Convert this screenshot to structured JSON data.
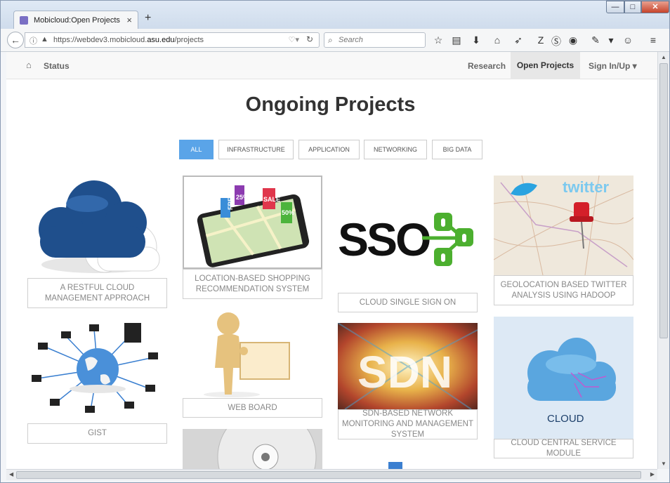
{
  "browser": {
    "tab_title": "Mobicloud:Open Projects",
    "tab_close": "×",
    "new_tab": "+",
    "url_prefix": "https://webdev3.mobicloud.",
    "url_domain": "asu.edu",
    "url_path": "/projects",
    "search_placeholder": "Search",
    "controls": {
      "minimize": "—",
      "maximize": "□",
      "close": "✕"
    }
  },
  "site_nav": {
    "status": "Status",
    "research": "Research",
    "open_projects": "Open Projects",
    "sign_in": "Sign In/Up ▾"
  },
  "page": {
    "heading": "Ongoing Projects",
    "filters": [
      "ALL",
      "INFRASTRUCTURE",
      "APPLICATION",
      "NETWORKING",
      "BIG DATA"
    ],
    "active_filter": "ALL"
  },
  "projects": [
    {
      "caption": "A RESTFUL CLOUD MANAGEMENT APPROACH",
      "image": "blue-cloud-icon"
    },
    {
      "caption": "LOCATION-BASED SHOPPING RECOMMENDATION SYSTEM",
      "image": "smartphone-map-tags-icon",
      "tags": [
        "FREE",
        "25%",
        "SALE",
        "50%"
      ]
    },
    {
      "caption": "CLOUD SINGLE SIGN ON",
      "image": "sso-logo-icon",
      "logo_text": "SSO"
    },
    {
      "caption": "GEOLOCATION BASED TWITTER ANALYSIS USING HADOOP",
      "image": "twitter-map-pin-icon",
      "logo_text": "twitter"
    },
    {
      "caption": "GIST",
      "image": "globe-network-icon"
    },
    {
      "caption": "WEB BOARD",
      "image": "figure-with-board-icon"
    },
    {
      "caption": "SDN-BASED NETWORK MONITORING AND MANAGEMENT SYSTEM",
      "image": "sdn-burst-icon",
      "logo_text": "SDN"
    },
    {
      "caption": "CLOUD CENTRAL SERVICE MODULE",
      "image": "circuit-cloud-icon",
      "logo_text": "CLOUD"
    }
  ],
  "colors": {
    "active_filter_bg": "#5aa4e8",
    "cloud_blue": "#1f4f8c",
    "sso_green": "#4caf2f",
    "close_red": "#c7432b"
  }
}
